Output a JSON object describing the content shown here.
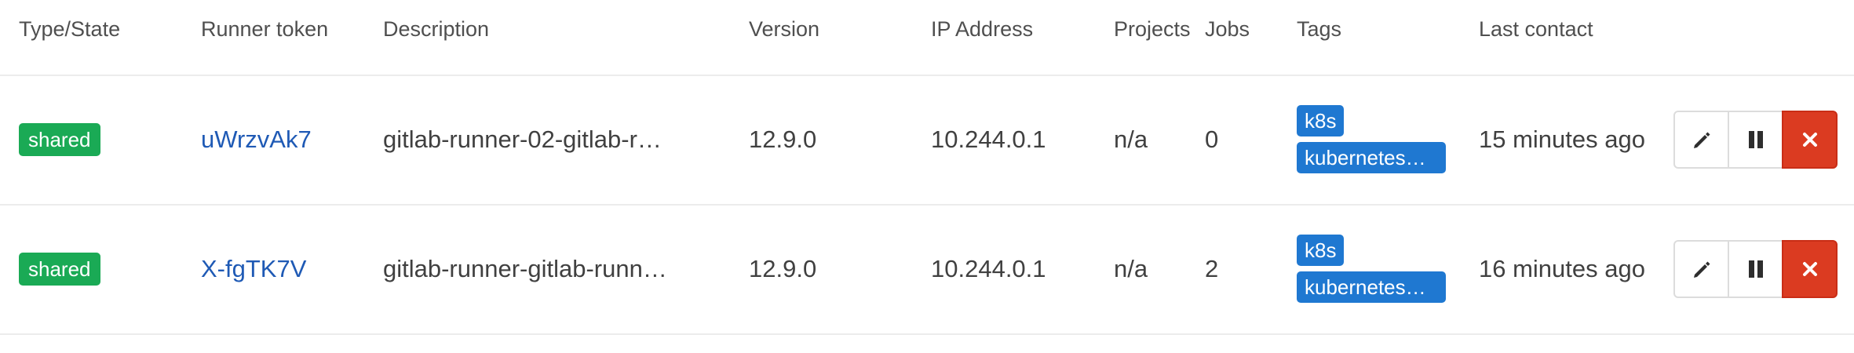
{
  "table": {
    "headers": {
      "type_state": "Type/State",
      "runner_token": "Runner token",
      "description": "Description",
      "version": "Version",
      "ip_address": "IP Address",
      "projects": "Projects",
      "jobs": "Jobs",
      "tags": "Tags",
      "last_contact": "Last contact"
    },
    "rows": [
      {
        "state": "shared",
        "token": "uWrzvAk7",
        "description": "gitlab-runner-02-gitlab-r…",
        "version": "12.9.0",
        "ip": "10.244.0.1",
        "projects": "n/a",
        "jobs": "0",
        "tags": [
          "k8s",
          "kubernetes…"
        ],
        "last_contact": "15 minutes ago"
      },
      {
        "state": "shared",
        "token": "X-fgTK7V",
        "description": "gitlab-runner-gitlab-runn…",
        "version": "12.9.0",
        "ip": "10.244.0.1",
        "projects": "n/a",
        "jobs": "2",
        "tags": [
          "k8s",
          "kubernetes…"
        ],
        "last_contact": "16 minutes ago"
      }
    ]
  },
  "actions": {
    "edit_icon": "pencil-icon",
    "pause_icon": "pause-icon",
    "remove_icon": "close-icon"
  },
  "colors": {
    "shared_badge": "#1aaa55",
    "tag": "#1f78d1",
    "token_link": "#1f5ab5",
    "remove_button": "#db3b21"
  }
}
